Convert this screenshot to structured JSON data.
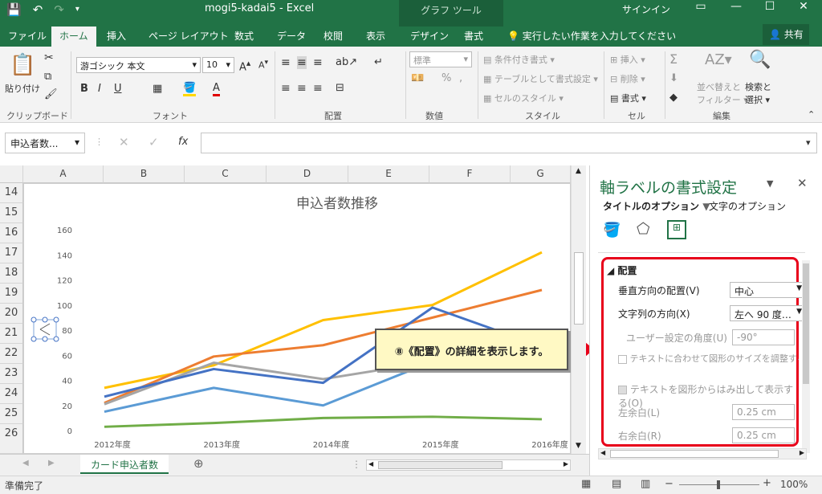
{
  "app": {
    "window_title": "mogi5-kadai5  -  Excel",
    "context_tab": "グラフ ツール",
    "signin": "サインイン",
    "share": "共有",
    "search_hint": "実行したい作業を入力してください"
  },
  "tabs": [
    "ファイル",
    "ホーム",
    "挿入",
    "ページ レイアウト",
    "数式",
    "データ",
    "校閲",
    "表示",
    "デザイン",
    "書式"
  ],
  "ribbon": {
    "clipboard": {
      "paste": "貼り付け",
      "label": "クリップボード"
    },
    "font": {
      "name": "游ゴシック 本文",
      "size": "10",
      "label": "フォント",
      "bold": "B",
      "italic": "I",
      "underline": "U"
    },
    "alignment": {
      "label": "配置"
    },
    "number": {
      "format": "標準",
      "label": "数値",
      "percent": "%"
    },
    "style": {
      "conditional": "条件付き書式",
      "table": "テーブルとして書式設定",
      "cell_style": "セルのスタイル",
      "label": "スタイル"
    },
    "cells": {
      "insert": "挿入",
      "delete": "削除",
      "format": "書式",
      "label": "セル"
    },
    "editing": {
      "sort": "並べ替えと",
      "filter": "フィルター",
      "find": "検索と",
      "select": "選択",
      "label": "編集"
    }
  },
  "formula_bar": {
    "name_box": "申込者数...",
    "fx": "fx",
    "value": ""
  },
  "columns": [
    "A",
    "B",
    "C",
    "D",
    "E",
    "F",
    "G"
  ],
  "rows": [
    "14",
    "15",
    "16",
    "17",
    "18",
    "19",
    "20",
    "21",
    "22",
    "23",
    "24",
    "25",
    "26"
  ],
  "chart_data": {
    "type": "line",
    "title": "申込者数推移",
    "categories": [
      "2012年度",
      "2013年度",
      "2014年度",
      "2015年度",
      "2016年度"
    ],
    "ylim": [
      0,
      160
    ],
    "yticks": [
      "0",
      "20",
      "40",
      "60",
      "80",
      "100",
      "120",
      "140",
      "160"
    ],
    "grid": false,
    "series": [
      {
        "color": "#ffc000",
        "values": [
          34,
          52,
          88,
          100,
          142
        ]
      },
      {
        "color": "#ed7d31",
        "values": [
          22,
          59,
          68,
          90,
          112
        ]
      },
      {
        "color": "#a5a5a5",
        "values": [
          21,
          54,
          41,
          55,
          62
        ]
      },
      {
        "color": "#4472c4",
        "values": [
          27,
          49,
          38,
          98,
          67
        ]
      },
      {
        "color": "#5b9bd5",
        "values": [
          15,
          34,
          20,
          55,
          52
        ]
      },
      {
        "color": "#70ad47",
        "values": [
          3,
          6,
          10,
          11,
          9
        ]
      }
    ]
  },
  "callout": {
    "text": "⑧《配置》の詳細を表示します。"
  },
  "pane": {
    "title": "軸ラベルの書式設定",
    "tab_title_options": "タイトルのオプション",
    "tab_text_options": "文字のオプション",
    "section_title": "配置",
    "vertical_align_label": "垂直方向の配置(V)",
    "vertical_align_value": "中心",
    "text_direction_label": "文字列の方向(X)",
    "text_direction_value": "左へ 90 度…",
    "custom_angle_label": "ユーザー設定の角度(U)",
    "custom_angle_value": "-90°",
    "resize_label": "テキストに合わせて図形のサイズを調整する(F)",
    "overflow_label": "テキストを図形からはみ出して表示する(O)",
    "left_margin_label": "左余白(L)",
    "left_margin_value": "0.25 cm",
    "right_margin_label": "右余白(R)",
    "right_margin_value": "0.25 cm"
  },
  "sheet": {
    "tab": "カード申込者数"
  },
  "status": {
    "ready": "準備完了",
    "zoom": "100%"
  }
}
